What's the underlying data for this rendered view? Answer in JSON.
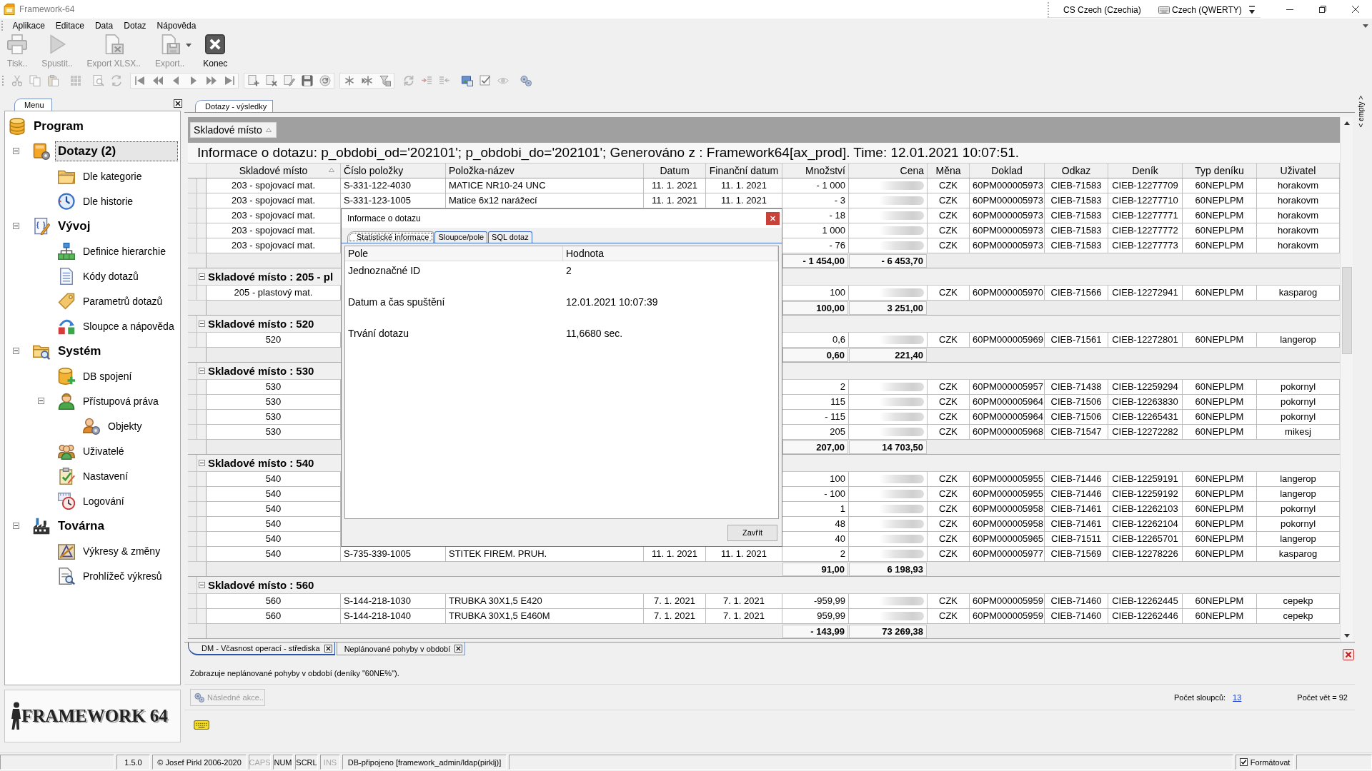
{
  "window": {
    "title": "Framework-64",
    "language": "CS Czech (Czechia)",
    "keyboard": "Czech (QWERTY)",
    "side_panel": "< empty >"
  },
  "menu": [
    "Aplikace",
    "Editace",
    "Data",
    "Dotaz",
    "Nápověda"
  ],
  "toolbar": [
    {
      "kind": "print",
      "label": "Tisk..",
      "disabled": true,
      "dropdown": false
    },
    {
      "kind": "run",
      "label": "Spustit..",
      "disabled": true,
      "dropdown": false
    },
    {
      "kind": "xlsx",
      "label": "Export XLSX..",
      "disabled": true,
      "dropdown": false
    },
    {
      "kind": "export",
      "label": "Export..",
      "disabled": true,
      "dropdown": true
    },
    {
      "kind": "exit",
      "label": "Konec",
      "disabled": false,
      "dropdown": false
    }
  ],
  "tool_groups": [
    {
      "framed": false,
      "tools": [
        {
          "kind": "cut"
        },
        {
          "kind": "copy"
        },
        {
          "kind": "paste"
        }
      ]
    },
    {
      "framed": false,
      "tools": [
        {
          "kind": "grid"
        }
      ]
    },
    {
      "framed": false,
      "tools": [
        {
          "kind": "find"
        },
        {
          "kind": "replace"
        }
      ]
    },
    {
      "framed": true,
      "tools": [
        {
          "kind": "first"
        },
        {
          "kind": "prevpage"
        },
        {
          "kind": "prev"
        },
        {
          "kind": "next"
        },
        {
          "kind": "nextpage"
        },
        {
          "kind": "last"
        }
      ]
    },
    {
      "framed": true,
      "tools": [
        {
          "kind": "add"
        },
        {
          "kind": "remove"
        },
        {
          "kind": "edit"
        },
        {
          "kind": "save"
        },
        {
          "kind": "reload"
        }
      ]
    },
    {
      "framed": true,
      "tools": [
        {
          "kind": "star"
        },
        {
          "kind": "starplus"
        },
        {
          "kind": "filter"
        }
      ]
    },
    {
      "framed": false,
      "tools": [
        {
          "kind": "refresh"
        },
        {
          "kind": "indent"
        },
        {
          "kind": "outdent"
        }
      ]
    },
    {
      "framed": false,
      "tools": [
        {
          "kind": "picture"
        },
        {
          "kind": "check"
        },
        {
          "kind": "eye"
        }
      ]
    },
    {
      "framed": false,
      "tools": [
        {
          "kind": "gears"
        }
      ]
    }
  ],
  "sidebar": {
    "tab": "Menu",
    "tree": [
      {
        "label": "Program",
        "kind": "database",
        "selected": false,
        "children": [
          {
            "label": "Dotazy (2)",
            "kind": "querybox",
            "selected": true,
            "expanded": true,
            "children": [
              {
                "label": "Dle kategorie",
                "kind": "folder",
                "selected": false
              },
              {
                "label": "Dle historie",
                "kind": "clock",
                "selected": false
              }
            ]
          },
          {
            "label": "Vývoj",
            "kind": "code",
            "selected": false,
            "expanded": true,
            "children": [
              {
                "label": "Definice hierarchie",
                "kind": "hierarchy",
                "selected": false
              },
              {
                "label": "Kódy dotazů",
                "kind": "document",
                "selected": false
              },
              {
                "label": "Parametrů dotazů",
                "kind": "tag",
                "selected": false
              },
              {
                "label": "Sloupce a nápověda",
                "kind": "columns",
                "selected": false
              }
            ]
          },
          {
            "label": "Systém",
            "kind": "sysfolder",
            "selected": false,
            "expanded": true,
            "children": [
              {
                "label": "DB spojení",
                "kind": "dbadd",
                "selected": false
              },
              {
                "label": "Přístupová práva",
                "kind": "access",
                "selected": false,
                "expanded": true,
                "children": [
                  {
                    "label": "Objekty",
                    "kind": "objects",
                    "selected": false
                  }
                ]
              },
              {
                "label": "Uživatelé",
                "kind": "users",
                "selected": false
              },
              {
                "label": "Nastavení",
                "kind": "settings",
                "selected": false
              },
              {
                "label": "Logování",
                "kind": "log",
                "selected": false
              }
            ]
          },
          {
            "label": "Továrna",
            "kind": "factory",
            "selected": false,
            "expanded": true,
            "children": [
              {
                "label": "Výkresy & změny",
                "kind": "drawings",
                "selected": false
              },
              {
                "label": "Prohlížeč výkresů",
                "kind": "viewer",
                "selected": false
              }
            ]
          }
        ]
      }
    ],
    "logo": "FRAMEWORK 64"
  },
  "results": {
    "tab": "Dotazy - výsledky",
    "group_by": {
      "label": "Skladové místo",
      "sorted": true
    },
    "info": "Informace o dotazu: p_obdobi_od='202101'; p_obdobi_do='202101'; Generováno z : Framework64[ax_prod]. Time: 12.01.2021 10:07:51.",
    "columns": [
      {
        "label": "Skladové místo",
        "sorted": true
      },
      {
        "label": "Číslo položky",
        "sorted": false
      },
      {
        "label": "Položka-název",
        "sorted": false
      },
      {
        "label": "Datum",
        "sorted": false
      },
      {
        "label": "Finanční datum",
        "sorted": false
      },
      {
        "label": "Množství",
        "sorted": false
      },
      {
        "label": "Cena",
        "sorted": false
      },
      {
        "label": "Měna",
        "sorted": false
      },
      {
        "label": "Doklad",
        "sorted": false
      },
      {
        "label": "Odkaz",
        "sorted": false
      },
      {
        "label": "Deník",
        "sorted": false
      },
      {
        "label": "Typ deníku",
        "sorted": false
      },
      {
        "label": "Uživatel",
        "sorted": false
      }
    ],
    "prices_blurred": true,
    "groups": [
      {
        "rows": [
          {
            "location": "203 - spojovací mat.",
            "item_no": "S-331-122-4030",
            "item_name": "MATICE NR10-24 UNC",
            "date": "11. 1. 2021",
            "fin_date": "11. 1. 2021",
            "qty": "- 1 000",
            "currency": "CZK",
            "doc": "60PM000005973",
            "ref": "CIEB-71583",
            "journal": "CIEB-12277709",
            "journal_type": "60NEPLPM",
            "user": "horakovm"
          },
          {
            "location": "203 - spojovací mat.",
            "item_no": "S-331-123-1005",
            "item_name": "Matice 6x12 narážecí",
            "date": "11. 1. 2021",
            "fin_date": "11. 1. 2021",
            "qty": "- 3",
            "currency": "CZK",
            "doc": "60PM000005973",
            "ref": "CIEB-71583",
            "journal": "CIEB-12277710",
            "journal_type": "60NEPLPM",
            "user": "horakovm"
          },
          {
            "location": "203 - spojovací mat.",
            "qty": "- 18",
            "currency": "CZK",
            "doc": "60PM000005973",
            "ref": "CIEB-71583",
            "journal": "CIEB-12277771",
            "journal_type": "60NEPLPM",
            "user": "horakovm"
          },
          {
            "location": "203 - spojovací mat.",
            "qty": "1 000",
            "currency": "CZK",
            "doc": "60PM000005973",
            "ref": "CIEB-71583",
            "journal": "CIEB-12277772",
            "journal_type": "60NEPLPM",
            "user": "horakovm"
          },
          {
            "location": "203 - spojovací mat.",
            "qty": "- 76",
            "currency": "CZK",
            "doc": "60PM000005973",
            "ref": "CIEB-71583",
            "journal": "CIEB-12277773",
            "journal_type": "60NEPLPM",
            "user": "horakovm"
          }
        ],
        "total_qty": "- 1 454,00",
        "total_price": "- 6 453,70"
      },
      {
        "label": "Skladové místo : 205 - pl",
        "expanded": true,
        "rows": [
          {
            "location": "205 - plastový mat.",
            "qty": "100",
            "currency": "CZK",
            "doc": "60PM000005970",
            "ref": "CIEB-71566",
            "journal": "CIEB-12272941",
            "journal_type": "60NEPLPM",
            "user": "kasparog"
          }
        ],
        "total_qty": "100,00",
        "total_price": "3 251,00"
      },
      {
        "label": "Skladové místo : 520",
        "expanded": true,
        "rows": [
          {
            "location": "520",
            "qty": "0,6",
            "currency": "CZK",
            "doc": "60PM000005969",
            "ref": "CIEB-71561",
            "journal": "CIEB-12272801",
            "journal_type": "60NEPLPM",
            "user": "langerop"
          }
        ],
        "total_qty": "0,60",
        "total_price": "221,40"
      },
      {
        "label": "Skladové místo : 530",
        "expanded": true,
        "rows": [
          {
            "location": "530",
            "qty": "2",
            "currency": "CZK",
            "doc": "60PM000005957",
            "ref": "CIEB-71438",
            "journal": "CIEB-12259294",
            "journal_type": "60NEPLPM",
            "user": "pokornyl"
          },
          {
            "location": "530",
            "qty": "115",
            "currency": "CZK",
            "doc": "60PM000005964",
            "ref": "CIEB-71506",
            "journal": "CIEB-12263830",
            "journal_type": "60NEPLPM",
            "user": "pokornyl"
          },
          {
            "location": "530",
            "qty": "- 115",
            "currency": "CZK",
            "doc": "60PM000005964",
            "ref": "CIEB-71506",
            "journal": "CIEB-12265431",
            "journal_type": "60NEPLPM",
            "user": "pokornyl"
          },
          {
            "location": "530",
            "qty": "205",
            "currency": "CZK",
            "doc": "60PM000005968",
            "ref": "CIEB-71547",
            "journal": "CIEB-12272282",
            "journal_type": "60NEPLPM",
            "user": "mikesj"
          }
        ],
        "total_qty": "207,00",
        "total_price": "14 703,50"
      },
      {
        "label": "Skladové místo : 540",
        "expanded": true,
        "rows": [
          {
            "location": "540",
            "qty": "100",
            "currency": "CZK",
            "doc": "60PM000005955",
            "ref": "CIEB-71446",
            "journal": "CIEB-12259191",
            "journal_type": "60NEPLPM",
            "user": "langerop"
          },
          {
            "location": "540",
            "qty": "- 100",
            "currency": "CZK",
            "doc": "60PM000005955",
            "ref": "CIEB-71446",
            "journal": "CIEB-12259192",
            "journal_type": "60NEPLPM",
            "user": "langerop"
          },
          {
            "location": "540",
            "qty": "1",
            "currency": "CZK",
            "doc": "60PM000005958",
            "ref": "CIEB-71461",
            "journal": "CIEB-12262103",
            "journal_type": "60NEPLPM",
            "user": "pokornyl"
          },
          {
            "location": "540",
            "qty": "48",
            "currency": "CZK",
            "doc": "60PM000005958",
            "ref": "CIEB-71461",
            "journal": "CIEB-12262104",
            "journal_type": "60NEPLPM",
            "user": "pokornyl"
          },
          {
            "location": "540",
            "qty": "40",
            "currency": "CZK",
            "doc": "60PM000005965",
            "ref": "CIEB-71511",
            "journal": "CIEB-12265701",
            "journal_type": "60NEPLPM",
            "user": "langerop"
          },
          {
            "location": "540",
            "item_no": "S-735-339-1005",
            "item_name": "STITEK FIREM. PRUH.",
            "date": "11. 1. 2021",
            "fin_date": "11. 1. 2021",
            "qty": "2",
            "currency": "CZK",
            "doc": "60PM000005977",
            "ref": "CIEB-71569",
            "journal": "CIEB-12278226",
            "journal_type": "60NEPLPM",
            "user": "kasparog"
          }
        ],
        "total_qty": "91,00",
        "total_price": "6 198,93"
      },
      {
        "label": "Skladové místo : 560",
        "expanded": true,
        "rows": [
          {
            "location": "560",
            "item_no": "S-144-218-1030",
            "item_name": "TRUBKA 30X1,5 E420",
            "date": "7. 1. 2021",
            "fin_date": "7. 1. 2021",
            "qty": "-959,99",
            "currency": "CZK",
            "doc": "60PM000005959",
            "ref": "CIEB-71460",
            "journal": "CIEB-12262445",
            "journal_type": "60NEPLPM",
            "user": "cepekp"
          },
          {
            "location": "560",
            "item_no": "S-144-218-1040",
            "item_name": "TRUBKA 30X1,5 E460M",
            "date": "7. 1. 2021",
            "fin_date": "7. 1. 2021",
            "qty": "959,99",
            "currency": "CZK",
            "doc": "60PM000005959",
            "ref": "CIEB-71460",
            "journal": "CIEB-12262446",
            "journal_type": "60NEPLPM",
            "user": "cepekp"
          }
        ],
        "total_qty": "- 143,99",
        "total_price": "73 269,38"
      }
    ],
    "dialog": {
      "title": "Informace o dotazu",
      "tabs": [
        {
          "label": "Statistické informace",
          "selected": true
        },
        {
          "label": "Sloupce/pole",
          "selected": false
        },
        {
          "label": "SQL dotaz",
          "selected": false
        }
      ],
      "columns": [
        "Pole",
        "Hodnota"
      ],
      "rows": [
        {
          "field": "Jednoznačné ID",
          "value": "2"
        },
        {
          "field": "Datum a čas spuštění",
          "value": "12.01.2021 10:07:39"
        },
        {
          "field": "Trvání dotazu",
          "value": "11,6680 sec."
        }
      ],
      "button": "Zavřít"
    }
  },
  "query_tabs": [
    {
      "label": "DM - Včasnost operací - střediska",
      "selected": true
    },
    {
      "label": "Neplánované pohyby v období",
      "selected": false
    }
  ],
  "description": "Zobrazuje neplánované pohyby v období (deníky \"60NE%\").",
  "action": {
    "label": "Následné akce..",
    "disabled": true
  },
  "column_count": {
    "label": "Počet sloupců:",
    "value": "13"
  },
  "record_count": "Počet vět = 92",
  "status_bar": {
    "panels": [
      {
        "text": "1.5.0",
        "disabled": false
      },
      {
        "text": "© Josef Pirkl 2006-2020",
        "disabled": false
      },
      {
        "text": "CAPS",
        "disabled": true
      },
      {
        "text": "NUM",
        "disabled": false
      },
      {
        "text": "SCRL",
        "disabled": false
      },
      {
        "text": "INS",
        "disabled": true
      },
      {
        "text": "DB-připojeno [framework_admin/ldap(pirklj)]",
        "disabled": false
      }
    ],
    "format": {
      "label": "Formátovat",
      "checked": true
    }
  }
}
